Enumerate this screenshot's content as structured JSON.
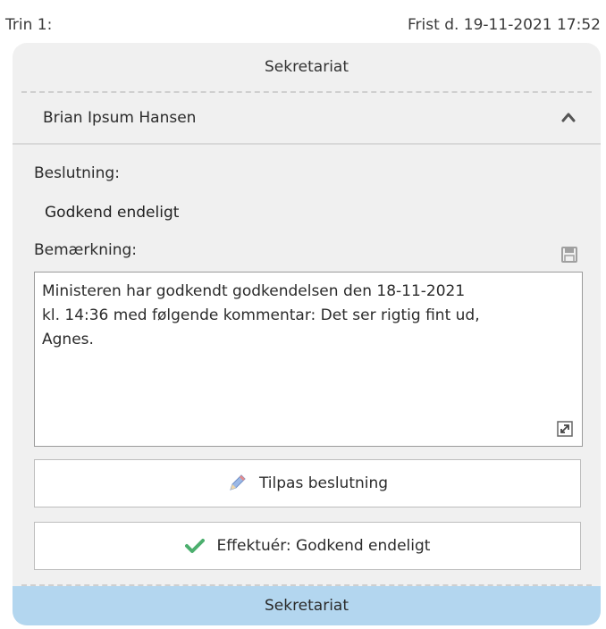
{
  "header": {
    "step_label": "Trin 1:",
    "deadline": "Frist d. 19-11-2021 17:52"
  },
  "card": {
    "title": "Sekretariat",
    "person": "Brian Ipsum Hansen",
    "decision_label": "Beslutning:",
    "decision_value": "Godkend endeligt",
    "remark_label": "Bemærkning:",
    "remark_text": "Ministeren har godkendt godkendelsen den 18-11-2021\nkl. 14:36 med følgende kommentar: Det ser rigtig fint ud,\nAgnes.",
    "adjust_button": "Tilpas beslutning",
    "execute_button": "Effektuér: Godkend endeligt",
    "footer": "Sekretariat"
  },
  "icons": {
    "caret": "chevron-up-icon",
    "save": "save-icon",
    "expand": "expand-icon",
    "pencil": "pencil-icon",
    "check": "checkmark-icon"
  },
  "colors": {
    "card_bg": "#f0f0f0",
    "footer_bg": "#b3d6ef",
    "check_green": "#4caf6e",
    "pencil_blue": "#7a9fd6"
  }
}
